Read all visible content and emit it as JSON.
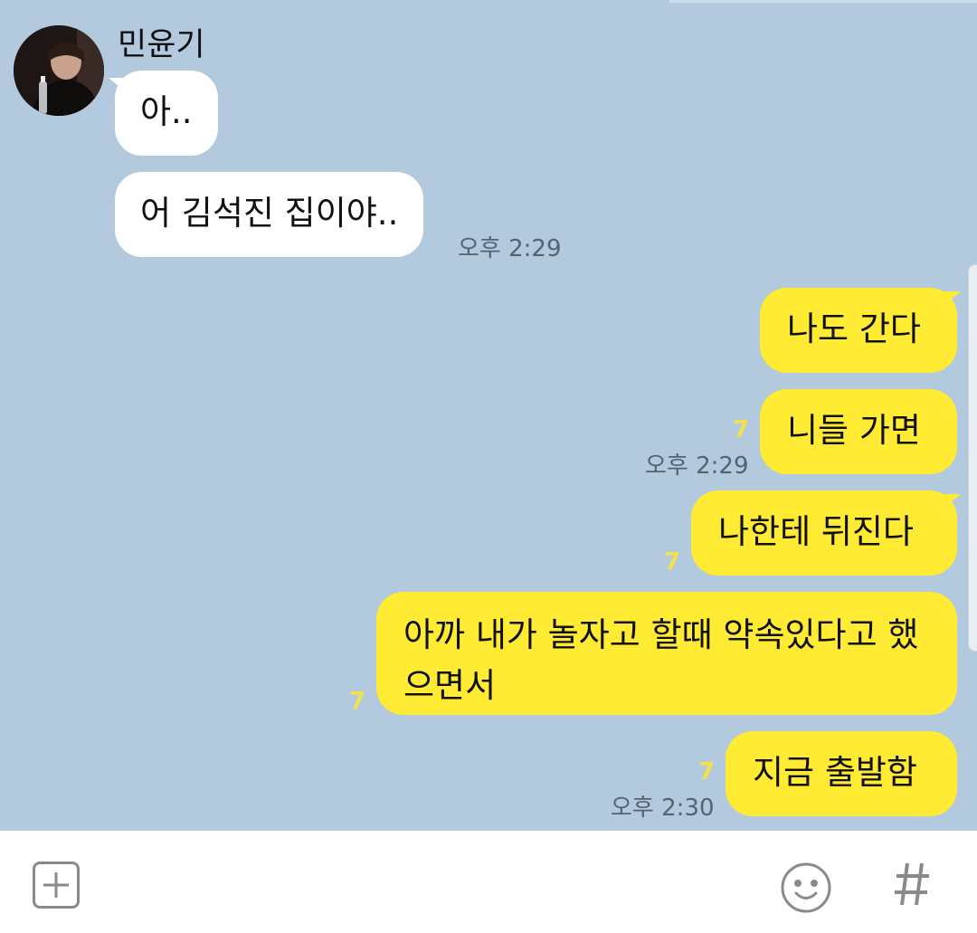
{
  "colors": {
    "chat_background": "#b3c9dd",
    "incoming_bubble": "#ffffff",
    "outgoing_bubble": "#ffeb33",
    "unread_count": "#f2e24d",
    "time_text": "#556270"
  },
  "contact": {
    "name": "민윤기",
    "avatar_icon": "profile-photo"
  },
  "messages": {
    "in1": "아..",
    "in2": "어 김석진 집이야..",
    "in_time": "오후 2:29",
    "out1": "나도 간다",
    "out2": "니들 가면",
    "out2_unread": "7",
    "out2_time": "오후 2:29",
    "out3": "나한테 뒤진다",
    "out3_unread": "7",
    "out4": "아까 내가 놀자고 할때 약속있다고 했으면서",
    "out4_unread": "7",
    "out5": "지금 출발함",
    "out5_unread": "7",
    "out5_time": "오후 2:30"
  },
  "input_bar": {
    "add_icon": "plus-icon",
    "emoji_icon": "smiley-icon",
    "hashtag_icon": "hash-icon"
  }
}
